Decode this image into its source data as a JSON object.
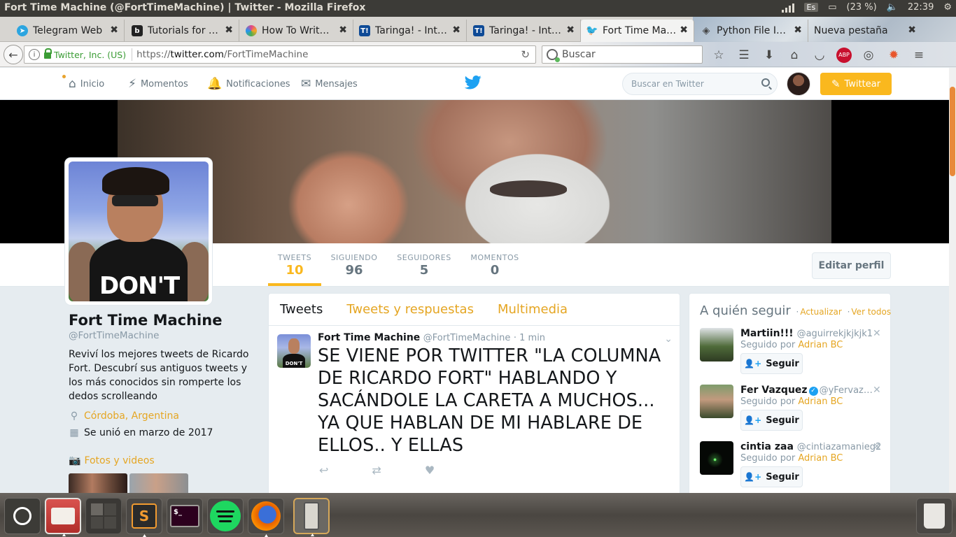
{
  "os": {
    "window_title": "Fort Time Machine (@FortTimeMachine) | Twitter - Mozilla Firefox",
    "battery": "(23 %)",
    "clock": "22:39",
    "keyboard_layout": "Es"
  },
  "browser": {
    "tabs": [
      {
        "label": "Telegram Web",
        "icon": "telegram-icon",
        "color": "#2ca5e0"
      },
      {
        "label": "Tutorials for …",
        "icon": "b-icon",
        "color": "#222222"
      },
      {
        "label": "How To Writ…",
        "icon": "colorful-circle-icon",
        "color": "#e0458b"
      },
      {
        "label": "Taringa! - Int…",
        "icon": "taringa-icon",
        "color": "#0e4a96"
      },
      {
        "label": "Taringa! - Int…",
        "icon": "taringa-icon",
        "color": "#0e4a96"
      },
      {
        "label": "Fort Time Ma…",
        "icon": "twitter-bird-icon",
        "color": "#1da1f2"
      },
      {
        "label": "Python File I…",
        "icon": "python-icon",
        "color": "#666666"
      },
      {
        "label": "Nueva pestaña",
        "icon": "none",
        "color": "#cccccc"
      }
    ],
    "url": {
      "org": "Twitter, Inc. (US)",
      "prefix": "https://",
      "host": "twitter.com",
      "path": "/FortTimeMachine"
    },
    "search_placeholder": "Buscar",
    "toolbar_icons": [
      "star-icon",
      "reading-list-icon",
      "download-icon",
      "home-icon",
      "pocket-icon",
      "adblock-icon",
      "shield-icon",
      "extension-icon",
      "menu-icon"
    ],
    "adblock_label": "ABP"
  },
  "twitter": {
    "nav": [
      {
        "label": "Inicio",
        "icon": "home-icon"
      },
      {
        "label": "Momentos",
        "icon": "lightning-icon"
      },
      {
        "label": "Notificaciones",
        "icon": "bell-icon"
      },
      {
        "label": "Mensajes",
        "icon": "envelope-icon"
      }
    ],
    "search_placeholder": "Buscar en Twitter",
    "tweet_button": "Twittear",
    "accent_color": "#fab81e"
  },
  "profile": {
    "name": "Fort Time Machine",
    "handle": "@FortTimeMachine",
    "bio": "Reviví los mejores tweets de Ricardo Fort. Descubrí sus antiguos tweets y los más conocidos sin romperte los dedos scrolleando",
    "location": "Córdoba, Argentina",
    "joined": "Se unió en marzo de 2017",
    "photos_label": "Fotos y videos",
    "avatar_shirt_text": "DON'T",
    "edit_button": "Editar perfil",
    "stats": [
      {
        "label": "TWEETS",
        "value": "10"
      },
      {
        "label": "SIGUIENDO",
        "value": "96"
      },
      {
        "label": "SEGUIDORES",
        "value": "5"
      },
      {
        "label": "MOMENTOS",
        "value": "0"
      }
    ]
  },
  "timeline": {
    "tabs": [
      "Tweets",
      "Tweets y respuestas",
      "Multimedia"
    ],
    "tweet": {
      "name": "Fort Time Machine",
      "handle": "@FortTimeMachine",
      "time": "· 1 min",
      "text": "SE VIENE POR TWITTER \"LA COLUMNA DE RICARDO FORT\" HABLANDO Y SACÁNDOLE LA CARETA A MUCHOS... YA QUE HABLAN DE MI HABLARE DE ELLOS.. Y ELLAS",
      "avatar_text": "DON'T"
    }
  },
  "who_to_follow": {
    "title": "A quién seguir",
    "refresh": "Actualizar",
    "view_all": "Ver todos",
    "follow_label": "Seguir",
    "followed_by_prefix": "Seguido por",
    "items": [
      {
        "name": "Martiin!!!",
        "handle": "@aguirrekjkjkjk1",
        "followed_by": "Adrian BC",
        "verified": false
      },
      {
        "name": "Fer Vazquez",
        "handle": "@yFervaz…",
        "followed_by": "Adrian BC",
        "verified": true
      },
      {
        "name": "cintia zaa",
        "handle": "@cintiazamanieg2",
        "followed_by": "Adrian BC",
        "verified": false
      }
    ]
  },
  "dock": {
    "items": [
      "ubuntu-logo-icon",
      "files-icon",
      "workspaces-icon",
      "sublime-text-icon",
      "terminal-icon",
      "spotify-icon",
      "firefox-icon",
      "phone-icon",
      "trash-icon"
    ],
    "sublime_label": "S",
    "terminal_label": "$_"
  }
}
